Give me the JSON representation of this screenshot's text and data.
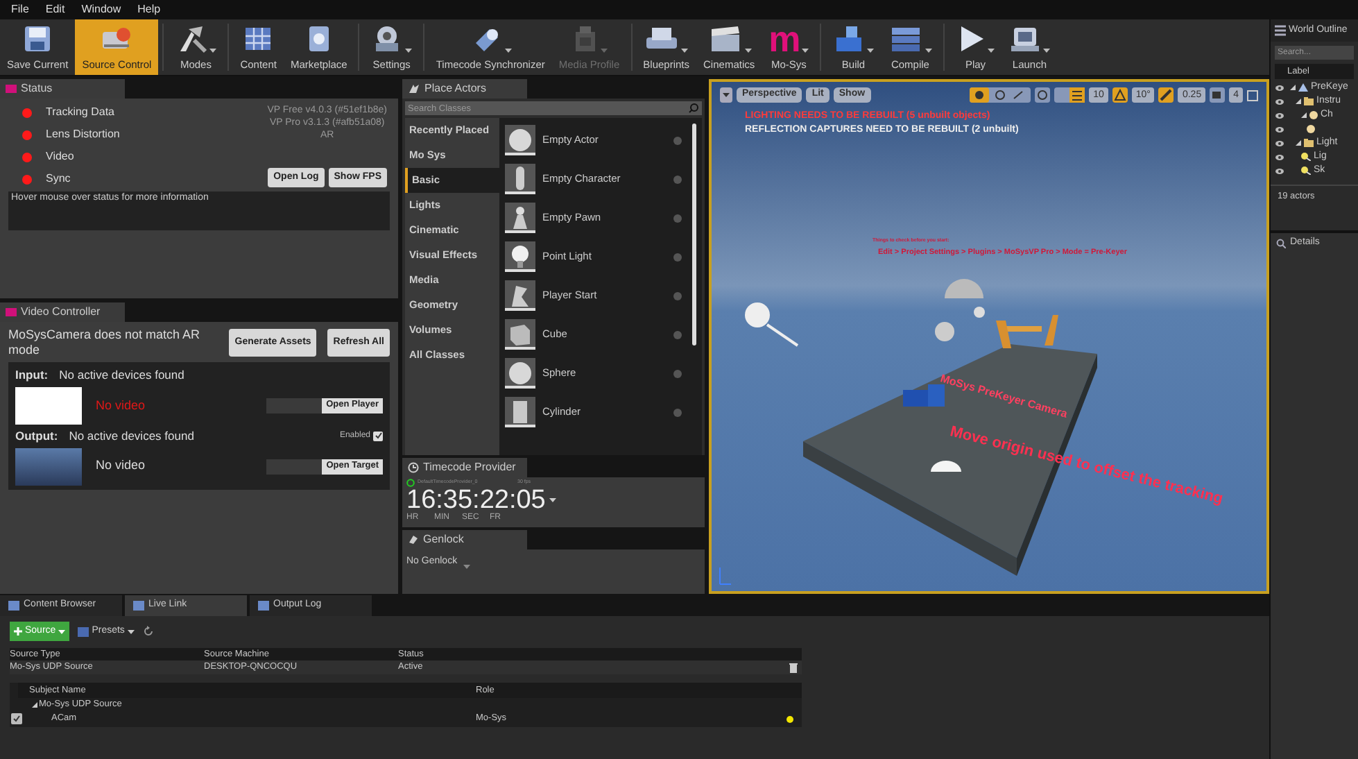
{
  "menu": [
    "File",
    "Edit",
    "Window",
    "Help"
  ],
  "toolbar": [
    {
      "label": "Save Current",
      "kind": "icon",
      "selected": false,
      "disabled": false,
      "menu": false
    },
    {
      "label": "Source Control",
      "kind": "icon",
      "selected": true,
      "disabled": false,
      "menu": false
    },
    {
      "label": "Modes",
      "kind": "icon",
      "selected": false,
      "disabled": false,
      "menu": true
    },
    {
      "label": "Content",
      "kind": "icon",
      "selected": false,
      "disabled": false,
      "menu": false
    },
    {
      "label": "Marketplace",
      "kind": "icon",
      "selected": false,
      "disabled": false,
      "menu": false
    },
    {
      "label": "Settings",
      "kind": "icon",
      "selected": false,
      "disabled": false,
      "menu": true
    },
    {
      "label": "Timecode Synchronizer",
      "kind": "icon",
      "selected": false,
      "disabled": false,
      "menu": true
    },
    {
      "label": "Media Profile",
      "kind": "icon",
      "selected": false,
      "disabled": true,
      "menu": true
    },
    {
      "label": "Blueprints",
      "kind": "icon",
      "selected": false,
      "disabled": false,
      "menu": true
    },
    {
      "label": "Cinematics",
      "kind": "icon",
      "selected": false,
      "disabled": false,
      "menu": true
    },
    {
      "label": "Mo-Sys",
      "kind": "letter",
      "glyph": "m",
      "selected": false,
      "disabled": false,
      "menu": true
    },
    {
      "label": "Build",
      "kind": "icon",
      "selected": false,
      "disabled": false,
      "menu": true
    },
    {
      "label": "Compile",
      "kind": "icon",
      "selected": false,
      "disabled": false,
      "menu": true
    },
    {
      "label": "Play",
      "kind": "icon",
      "selected": false,
      "disabled": false,
      "menu": true
    },
    {
      "label": "Launch",
      "kind": "icon",
      "selected": false,
      "disabled": false,
      "menu": true
    }
  ],
  "status_panel": {
    "tab": "Status",
    "indicators": [
      {
        "label": "Tracking Data",
        "color": "#ff1a1a"
      },
      {
        "label": "Lens Distortion",
        "color": "#ff1a1a"
      },
      {
        "label": "Video",
        "color": "#ff1a1a"
      },
      {
        "label": "Sync",
        "color": "#ff1a1a"
      }
    ],
    "version_lines": [
      "VP Free v4.0.3 (#51ef1b8e)",
      "VP Pro v3.1.3 (#afb51a08)",
      "AR"
    ],
    "buttons": [
      "Open Log",
      "Show FPS"
    ],
    "info": "Hover mouse over status for more information"
  },
  "video_controller": {
    "tab": "Video Controller",
    "message": "MoSysCamera does not match AR mode",
    "buttons": [
      "Generate Assets",
      "Refresh All"
    ],
    "input": {
      "label": "Input:",
      "devices": "No active devices found",
      "video": "No video",
      "button": "Open Player"
    },
    "output": {
      "label": "Output:",
      "devices": "No active devices found",
      "video": "No video",
      "button": "Open Target",
      "enabled_label": "Enabled",
      "enabled": true
    }
  },
  "place_actors": {
    "tab": "Place Actors",
    "search": {
      "placeholder": "Search Classes"
    },
    "categories": [
      {
        "label": "Recently Placed",
        "selected": false
      },
      {
        "label": "Mo Sys",
        "selected": false
      },
      {
        "label": "Basic",
        "selected": true
      },
      {
        "label": "Lights",
        "selected": false
      },
      {
        "label": "Cinematic",
        "selected": false
      },
      {
        "label": "Visual Effects",
        "selected": false
      },
      {
        "label": "Media",
        "selected": false
      },
      {
        "label": "Geometry",
        "selected": false
      },
      {
        "label": "Volumes",
        "selected": false
      },
      {
        "label": "All Classes",
        "selected": false
      }
    ],
    "items": [
      "Empty Actor",
      "Empty Character",
      "Empty Pawn",
      "Point Light",
      "Player Start",
      "Cube",
      "Sphere",
      "Cylinder"
    ]
  },
  "timecode_provider": {
    "tab": "Timecode Provider",
    "provider": "DefaultTimecodeProvider_0",
    "rate": "30 fps",
    "timecode": "16:35:22:05",
    "units": [
      "HR",
      "MIN",
      "SEC",
      "FR"
    ]
  },
  "genlock": {
    "tab": "Genlock",
    "value": "No Genlock"
  },
  "viewport": {
    "view": "Perspective",
    "lit": "Lit",
    "show": "Show",
    "grid": "10",
    "rotation": "10°",
    "scale": "0.25",
    "speed": "4",
    "warnings": [
      {
        "text": "LIGHTING NEEDS TO BE REBUILT (5 unbuilt objects)",
        "kind": "error"
      },
      {
        "text": "REFLECTION CAPTURES NEED TO BE REBUILT (2 unbuilt)",
        "kind": "info"
      }
    ],
    "scene_labels": [
      "Things to check before you start:",
      "Edit > Project Settings > Plugins > MoSysVP Pro > Mode = Pre-Keyer",
      "MoSys PreKeyer Camera",
      "Move origin used to offset the tracking"
    ]
  },
  "world_outliner": {
    "title": "World Outline",
    "search": {
      "placeholder": "Search..."
    },
    "column": "Label",
    "tree": [
      {
        "label": "PreKeye",
        "kind": "level",
        "expanded": true,
        "children": [
          {
            "label": "Instru",
            "kind": "folder",
            "expanded": true,
            "children": [
              {
                "label": "Ch",
                "kind": "actor",
                "expanded": true,
                "children": [
                  {
                    "kind": "actor"
                  }
                ]
              }
            ]
          },
          {
            "label": "Light",
            "kind": "folder",
            "expanded": true,
            "children": [
              {
                "label": "Lig",
                "kind": "light"
              },
              {
                "label": "Sk",
                "kind": "light"
              }
            ]
          }
        ]
      }
    ],
    "count": "19 actors"
  },
  "details": {
    "title": "Details"
  },
  "bottom_tabs": [
    {
      "label": "Content Browser",
      "selected": false
    },
    {
      "label": "Live Link",
      "selected": true
    },
    {
      "label": "Output Log",
      "selected": false
    }
  ],
  "live_link": {
    "source_button": "Source",
    "presets_button": "Presets",
    "sources": {
      "columns": [
        "Source Type",
        "Source Machine",
        "Status"
      ],
      "rows": [
        [
          "Mo-Sys UDP Source",
          "DESKTOP-QNCOCQU",
          "Active"
        ]
      ]
    },
    "subjects": {
      "columns": [
        "Subject Name",
        "Role"
      ],
      "groups": [
        {
          "label": "Mo-Sys UDP Source",
          "expanded": true,
          "subjects": [
            {
              "name": "ACam",
              "role": "Mo-Sys",
              "checked": true,
              "color": "#f2e600"
            }
          ]
        }
      ]
    }
  }
}
